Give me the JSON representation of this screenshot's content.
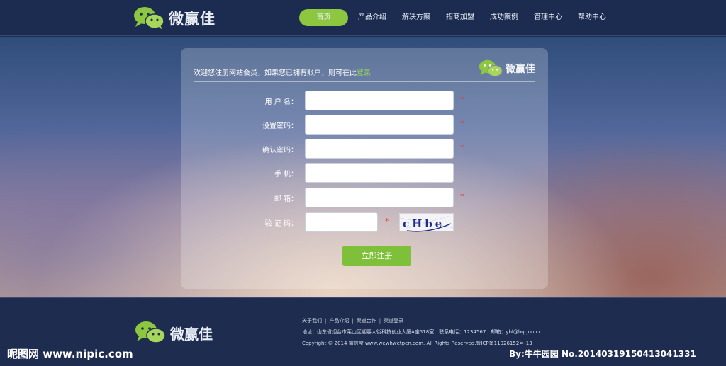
{
  "brand": {
    "name": "微赢佳"
  },
  "nav": {
    "items": [
      {
        "label": "首页",
        "active": true
      },
      {
        "label": "产品介绍"
      },
      {
        "label": "解决方案"
      },
      {
        "label": "招商加盟"
      },
      {
        "label": "成功案例"
      },
      {
        "label": "管理中心"
      },
      {
        "label": "帮助中心"
      }
    ]
  },
  "form": {
    "intro": "欢迎您注册网站会员，如果您已拥有账户，则可在此",
    "login_link": "登录",
    "fields": [
      {
        "label": "用 户 名：",
        "value": "",
        "required": true
      },
      {
        "label": "设置密码：",
        "value": "",
        "required": true
      },
      {
        "label": "确认密码：",
        "value": "",
        "required": true
      },
      {
        "label": "手    机：",
        "value": "",
        "required": false
      },
      {
        "label": "邮    箱：",
        "value": "",
        "required": true
      },
      {
        "label": "验 证 码：",
        "value": "",
        "required": true
      }
    ],
    "required_mark": "*",
    "captcha_text": "cHbe",
    "submit_label": "立即注册"
  },
  "footer": {
    "links": [
      "关于我们",
      "产品介绍",
      "渠道合作",
      "渠道登录"
    ],
    "separator": "|",
    "address": "地址：山东省烟台市莱山区迎春大街科技创业大厦A座518室　联系电话：1234567　邮箱：ybl@bqrjun.cc",
    "copyright": "Copyright © 2014 微信宝 www.wewhwetpen.com. All Rights Reserved.鲁ICP备11026152号-13"
  },
  "watermark": {
    "left": "昵图网 www.nipic.com",
    "right": "By:牛牛园园 No.20140319150413041331"
  },
  "colors": {
    "header_bg": "#1c2b50",
    "accent_green": "#8dc63f",
    "required_red": "#e2413f"
  },
  "icons": {
    "logo": "wechat-bubbles-icon"
  }
}
